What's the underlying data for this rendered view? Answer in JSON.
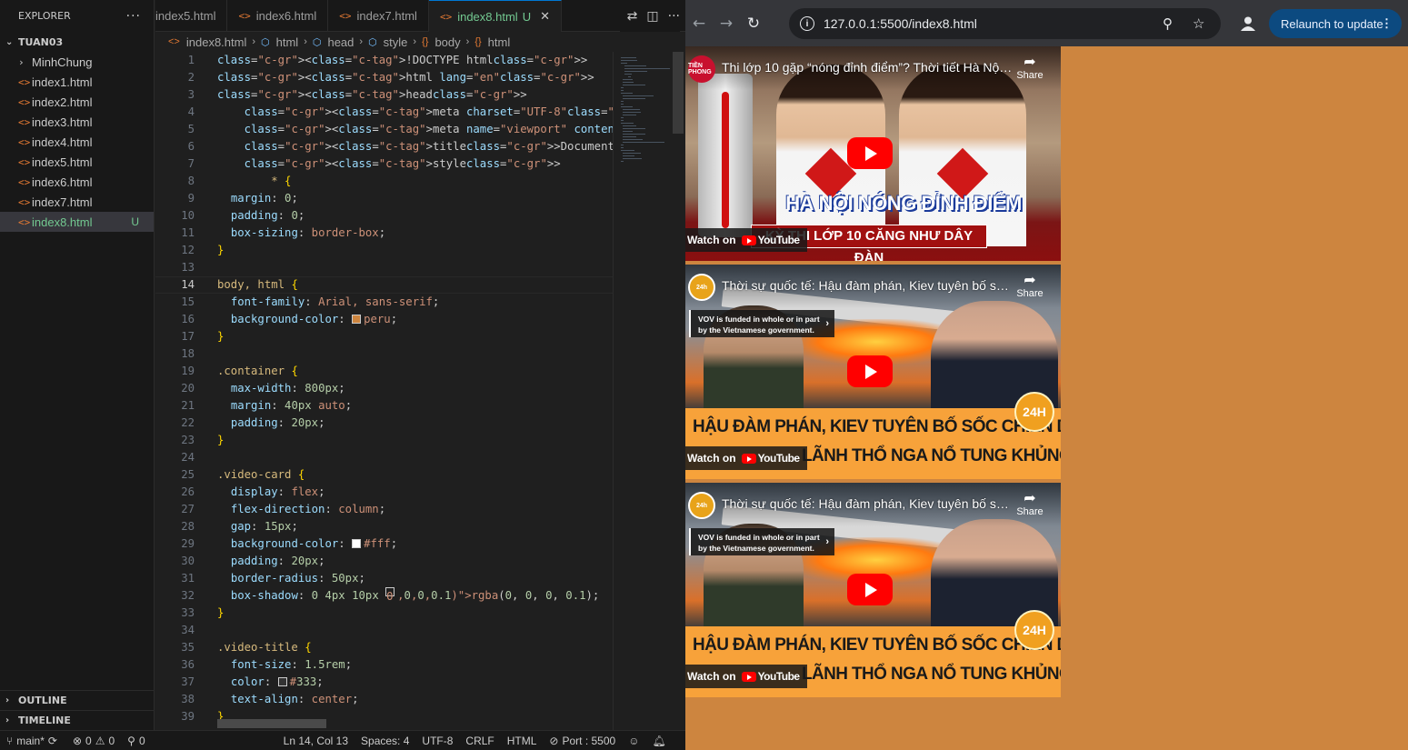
{
  "vscode": {
    "explorer": {
      "title": "EXPLORER",
      "more": "···",
      "folder": "TUAN03",
      "subfolder": "MinhChung",
      "files": [
        "index1.html",
        "index2.html",
        "index3.html",
        "index4.html",
        "index5.html",
        "index6.html",
        "index7.html",
        "index8.html"
      ],
      "active_file": "index8.html",
      "active_badge": "U",
      "outline": "OUTLINE",
      "timeline": "TIMELINE"
    },
    "tabs": [
      {
        "label": "index5.html"
      },
      {
        "label": "index6.html"
      },
      {
        "label": "index7.html"
      },
      {
        "label": "index8.html",
        "badge": "U",
        "active": true
      }
    ],
    "breadcrumb": [
      "index8.html",
      "html",
      "head",
      "style",
      "body",
      "html"
    ],
    "line_numbers": [
      "1",
      "2",
      "3",
      "4",
      "5",
      "6",
      "7",
      "8",
      "9",
      "10",
      "11",
      "12",
      "13",
      "14",
      "15",
      "16",
      "17",
      "18",
      "19",
      "20",
      "21",
      "22",
      "23",
      "24",
      "25",
      "26",
      "27",
      "28",
      "29",
      "30",
      "31",
      "32",
      "33",
      "34",
      "35",
      "36",
      "37",
      "38",
      "39"
    ],
    "code_lines": [
      "<!DOCTYPE html>",
      "<html lang=\"en\">",
      "<head>",
      "    <meta charset=\"UTF-8\">",
      "    <meta name=\"viewport\" content=\"width=device-width, ir",
      "    <title>Document</title>",
      "    <style>",
      "        * {",
      "  margin: 0;",
      "  padding: 0;",
      "  box-sizing: border-box;",
      "}",
      "",
      "body, html {",
      "  font-family: Arial, sans-serif;",
      "  background-color: peru;",
      "}",
      "",
      ".container {",
      "  max-width: 800px;",
      "  margin: 40px auto;",
      "  padding: 20px;",
      "}",
      "",
      ".video-card {",
      "  display: flex;",
      "  flex-direction: column;",
      "  gap: 15px;",
      "  background-color: #fff;",
      "  padding: 20px;",
      "  border-radius: 50px;",
      "  box-shadow: 0 4px 10px rgba(0, 0, 0, 0.1);",
      "}",
      "",
      ".video-title {",
      "  font-size: 1.5rem;",
      "  color: #333;",
      "  text-align: center;",
      "}"
    ],
    "current_line": "14",
    "status": {
      "branch": "main*",
      "errors": "0",
      "warnings": "0",
      "ports": "0",
      "position": "Ln 14, Col 13",
      "spaces": "Spaces: 4",
      "encoding": "UTF-8",
      "eol": "CRLF",
      "language": "HTML",
      "port": "Port : 5500"
    }
  },
  "browser": {
    "url": "127.0.0.1:5500/index8.html",
    "relaunch_label": "Relaunch to update",
    "page_background": "#cd853f",
    "videos": [
      {
        "title": "Thi lớp 10 gặp “nóng đỉnh điểm”? Thời tiết Hà Nội d...",
        "channel_logo": "TIỀN PHONG",
        "thumb_headline": "HÀ NỘI NÓNG ĐỈNH ĐIỂM",
        "thumb_sub": "KỲ THI LỚP 10 CĂNG NHƯ DÂY ĐÀN",
        "share": "Share",
        "watch_on": "Watch on",
        "youtube": "YouTube"
      },
      {
        "title": "Thời sự quốc tế: Hậu đàm phán, Kiev tuyên bố sốc ...",
        "channel_logo": "24h",
        "funding_note": "VOV is funded in whole or in part by the Vietnamese government.",
        "thumb_headline_1": "HẬU ĐÀM PHÁN, KIEV TUYÊN BỐ SỐC CHIẾN DỊCH",
        "thumb_headline_2": "LÃNH THỔ NGA NỔ TUNG KHỦNG KHIẾP",
        "badge": "24H",
        "share": "Share",
        "watch_on": "Watch on",
        "youtube": "YouTube"
      },
      {
        "title": "Thời sự quốc tế: Hậu đàm phán, Kiev tuyên bố sốc ...",
        "channel_logo": "24h",
        "funding_note": "VOV is funded in whole or in part by the Vietnamese government.",
        "thumb_headline_1": "HẬU ĐÀM PHÁN, KIEV TUYÊN BỐ SỐC CHIẾN DỊCH",
        "thumb_headline_2": "LÃNH THỔ NGA NỔ TUNG KHỦNG KHIẾP",
        "badge": "24H",
        "share": "Share",
        "watch_on": "Watch on",
        "youtube": "YouTube"
      }
    ]
  }
}
